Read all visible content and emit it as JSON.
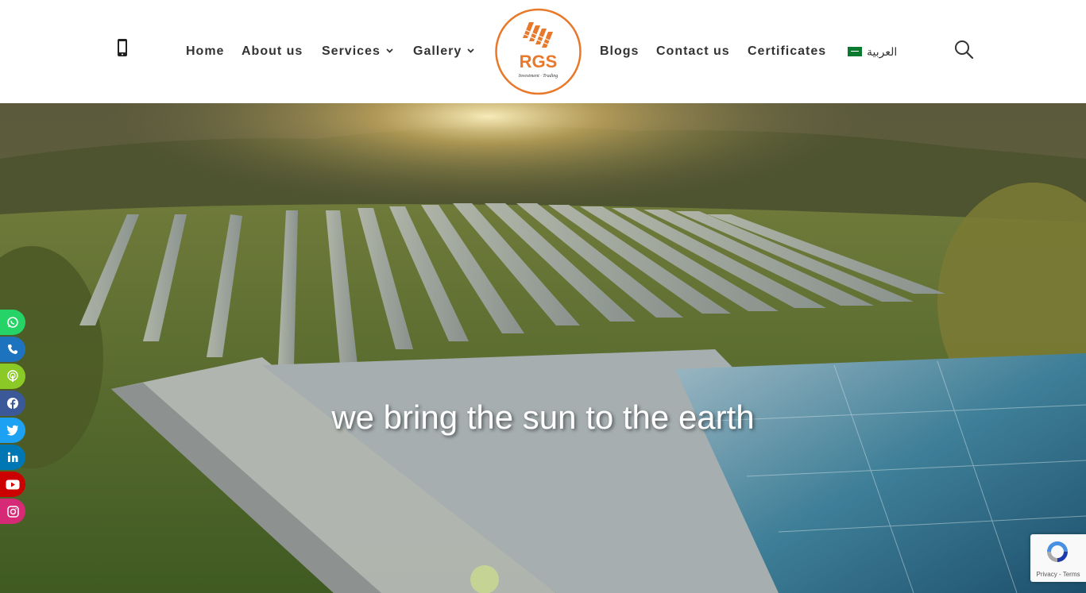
{
  "header": {
    "nav_left": [
      {
        "label": "Home"
      },
      {
        "label": "About us"
      },
      {
        "label": "Services"
      },
      {
        "label": "Gallery"
      }
    ],
    "nav_right": [
      {
        "label": "Blogs"
      },
      {
        "label": "Contact us"
      },
      {
        "label": "Certificates"
      }
    ],
    "language": {
      "label": "العربية",
      "flag_icon": "saudi-flag-icon"
    },
    "logo": {
      "text": "RGS",
      "subtitle": "Investment · Trading",
      "ring_color": "#e8782a",
      "text_color": "#e8782a"
    }
  },
  "hero": {
    "tagline": "we bring the sun to the earth"
  },
  "social": [
    {
      "name": "whatsapp-icon",
      "color": "#25d366"
    },
    {
      "name": "phone-icon",
      "color": "#1e73be"
    },
    {
      "name": "podcast-icon",
      "color": "#8ac926"
    },
    {
      "name": "facebook-icon",
      "color": "#3b5998"
    },
    {
      "name": "twitter-icon",
      "color": "#1da1f2"
    },
    {
      "name": "linkedin-icon",
      "color": "#0077b5"
    },
    {
      "name": "youtube-icon",
      "color": "#cc0000"
    },
    {
      "name": "instagram-icon",
      "color": "#d62976"
    }
  ],
  "recaptcha": {
    "terms": "Privacy - Terms"
  }
}
